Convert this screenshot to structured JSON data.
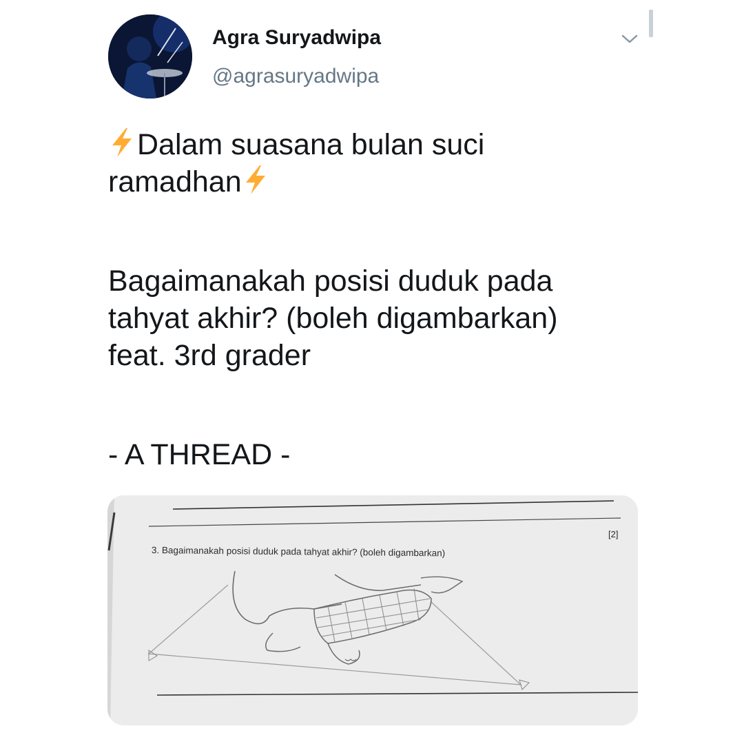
{
  "author": {
    "display_name": "Agra Suryadwipa",
    "handle": "@agrasuryadwipa"
  },
  "icons": {
    "avatar": "avatar-photo",
    "menu": "chevron-down-icon",
    "emoji": "high-voltage-emoji"
  },
  "tweet": {
    "line1": "Dalam suasana bulan suci",
    "line2": "ramadhan",
    "line3": "Bagaimanakah posisi duduk pada",
    "line4": "tahyat akhir? (boleh digambarkan)",
    "line5": "feat. 3rd grader",
    "line6": "- A THREAD -"
  },
  "media": {
    "question": "3. Bagaimanakah posisi duduk pada tahyat akhir? (boleh digambarkan)",
    "marks": "[2]"
  },
  "colors": {
    "text": "#14171a",
    "secondary": "#657786",
    "bolt": "#ffac33"
  }
}
